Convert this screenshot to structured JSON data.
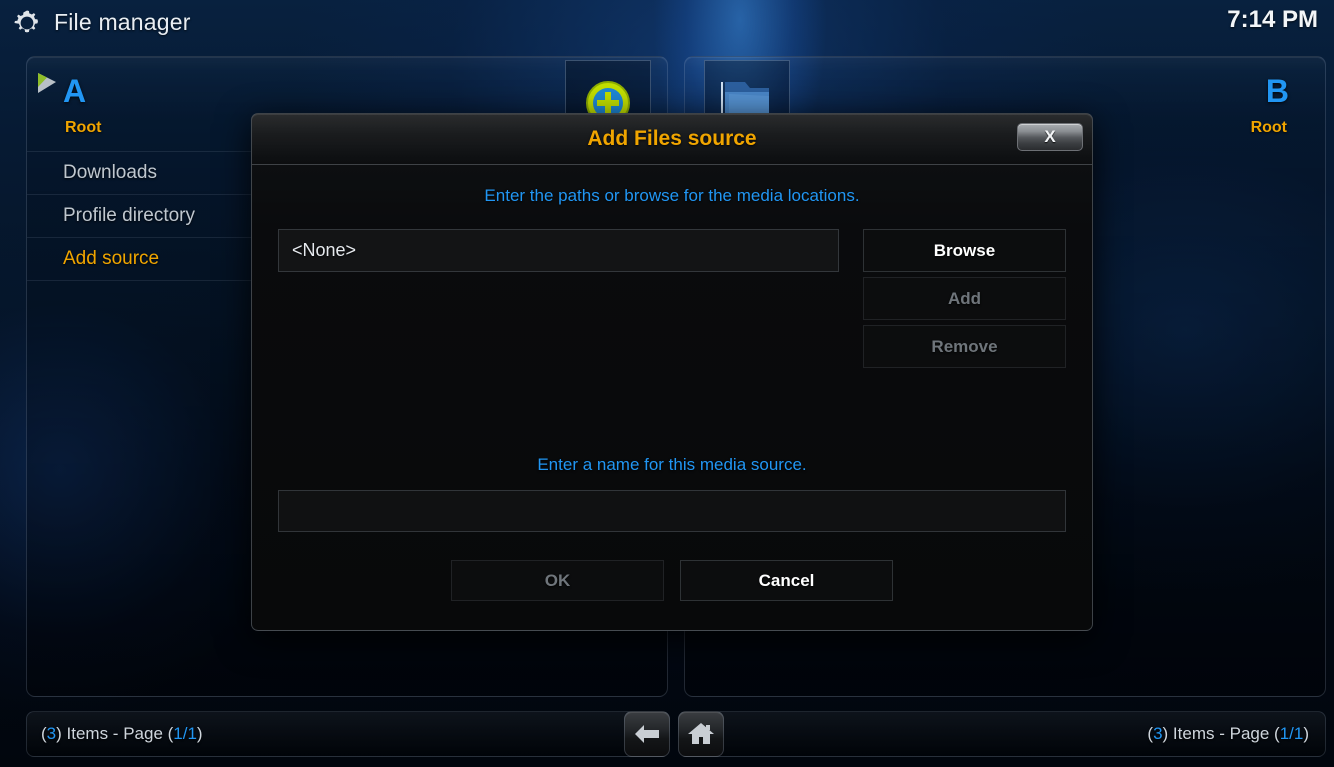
{
  "header": {
    "icon": "gear-icon",
    "title": "File manager",
    "clock": "7:14 PM"
  },
  "panels": [
    {
      "letter": "A",
      "focused": true,
      "root_label": "Root",
      "items": [
        {
          "label": "Downloads",
          "selected": false
        },
        {
          "label": "Profile directory",
          "selected": false
        },
        {
          "label": "Add source",
          "selected": true
        }
      ],
      "status": {
        "count": "3",
        "items_word": ") Items - Page (",
        "page": "1/1",
        "open_paren": "(",
        "close_paren": ")"
      }
    },
    {
      "letter": "B",
      "focused": false,
      "root_label": "Root",
      "items": [],
      "status": {
        "count": "3",
        "items_word": ") Items - Page (",
        "page": "1/1",
        "open_paren": "(",
        "close_paren": ")"
      }
    }
  ],
  "thumbnails": [
    {
      "name": "add-source-thumbnail",
      "label": "Add source",
      "icon": "plus-circle-icon"
    },
    {
      "name": "folder-thumbnail",
      "label": "",
      "icon": "folder-icon"
    }
  ],
  "nav": {
    "back_icon": "back-arrow-icon",
    "home_icon": "home-icon"
  },
  "dialog": {
    "title": "Add Files source",
    "close_label": "X",
    "hint_paths": "Enter the paths or browse for the media locations.",
    "paths": [
      {
        "value": "<None>",
        "selected": true
      }
    ],
    "side_buttons": [
      {
        "label": "Browse",
        "enabled": true
      },
      {
        "label": "Add",
        "enabled": false
      },
      {
        "label": "Remove",
        "enabled": false
      }
    ],
    "hint_name": "Enter a name for this media source.",
    "name_value": "",
    "name_placeholder": "",
    "actions": [
      {
        "label": "OK",
        "enabled": false
      },
      {
        "label": "Cancel",
        "enabled": true
      }
    ]
  },
  "colors": {
    "accent_orange": "#f0a500",
    "accent_blue": "#2196f3",
    "text_primary": "#e6eaee",
    "text_dim": "#6f757b"
  }
}
